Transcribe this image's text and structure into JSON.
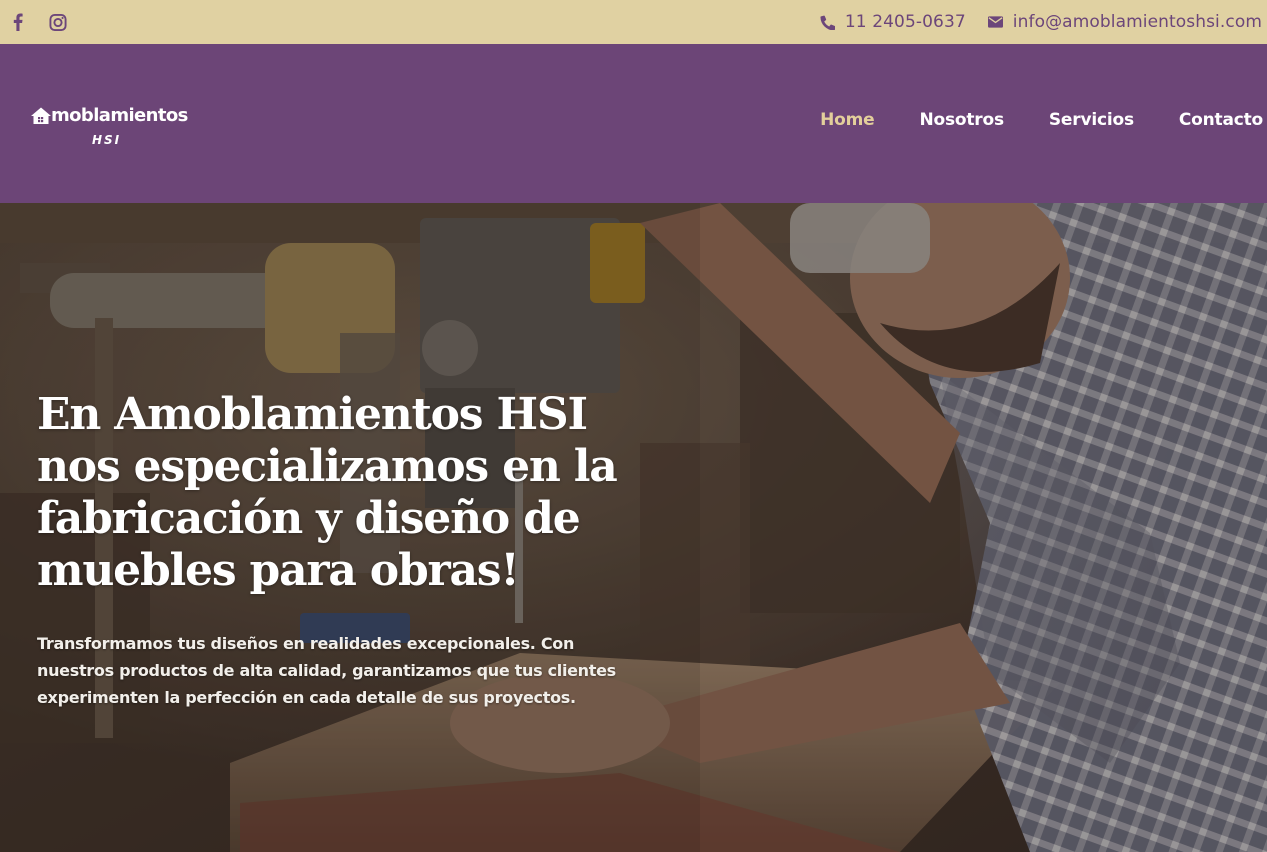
{
  "topbar": {
    "social": [
      {
        "name": "facebook",
        "icon": "facebook-icon"
      },
      {
        "name": "instagram",
        "icon": "instagram-icon"
      }
    ],
    "phone": {
      "icon": "phone-icon",
      "text": "11 2405-0637"
    },
    "email": {
      "icon": "envelope-icon",
      "text": "info@amoblamientoshsi.com"
    }
  },
  "header": {
    "logo": {
      "main": "moblamientos",
      "sub": "HSI"
    },
    "nav": [
      {
        "label": "Home",
        "active": true
      },
      {
        "label": "Nosotros",
        "active": false
      },
      {
        "label": "Servicios",
        "active": false
      },
      {
        "label": "Contacto",
        "active": false
      }
    ]
  },
  "hero": {
    "title": "En Amoblamientos HSI nos especializamos en la fabricación y diseño de muebles para obras!",
    "description": "Transformamos tus diseños en realidades excepcionales. Con nuestros productos de alta calidad, garantizamos que tus clientes experimenten la perfección en cada detalle de sus proyectos."
  },
  "colors": {
    "topbar_bg": "#e0d1a2",
    "header_bg": "#6c4577",
    "nav_active": "#e3cf9b",
    "icon_purple": "#6c467a",
    "text_white": "#ffffff"
  }
}
